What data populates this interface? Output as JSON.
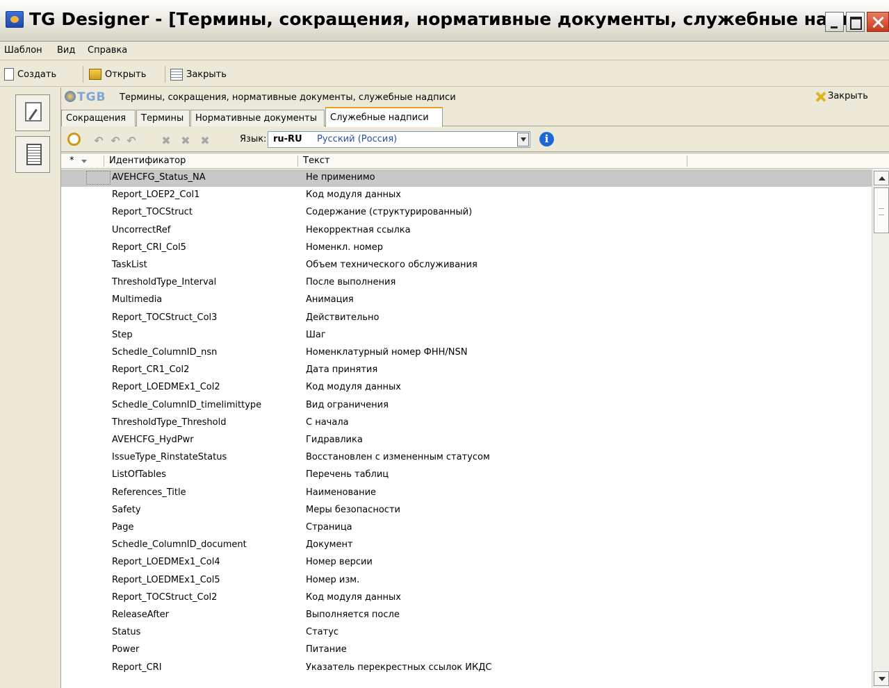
{
  "window": {
    "title": "TG Designer - [Термины, сокращения, нормативные документы, служебные надписи]"
  },
  "menu": [
    "Шаблон",
    "Вид",
    "Справка"
  ],
  "toolbar": {
    "create": "Создать",
    "open": "Открыть",
    "close": "Закрыть"
  },
  "doc": {
    "logo": "TGB",
    "title": "Термины, сокращения, нормативные документы, служебные надписи",
    "close": "Закрыть"
  },
  "tabs": [
    "Сокращения",
    "Термины",
    "Нормативные документы",
    "Служебные надписи"
  ],
  "active_tab": "Служебные надписи",
  "language": {
    "label": "Язык:",
    "code": "ru-RU",
    "name": "Русский (Россия)"
  },
  "grid": {
    "star": "*",
    "columns": [
      "Идентификатор",
      "Текст"
    ],
    "rows": [
      {
        "id": "AVEHCFG_Status_NA",
        "text": "Не применимо"
      },
      {
        "id": "Report_LOEP2_Col1",
        "text": "Код модуля данных"
      },
      {
        "id": "Report_TOCStruct",
        "text": "Содержание (структурированный)"
      },
      {
        "id": "UncorrectRef",
        "text": "Некорректная ссылка"
      },
      {
        "id": "Report_CRI_Col5",
        "text": "Номенкл. номер"
      },
      {
        "id": "TaskList",
        "text": "Объем технического обслуживания"
      },
      {
        "id": "ThresholdType_Interval",
        "text": "После выполнения"
      },
      {
        "id": "Multimedia",
        "text": "Анимация"
      },
      {
        "id": "Report_TOCStruct_Col3",
        "text": "Действительно"
      },
      {
        "id": "Step",
        "text": "Шаг"
      },
      {
        "id": "Schedle_ColumnID_nsn",
        "text": "Номенклатурный номер ФНН/NSN"
      },
      {
        "id": "Report_CR1_Col2",
        "text": "Дата принятия"
      },
      {
        "id": "Report_LOEDMEx1_Col2",
        "text": "Код модуля данных"
      },
      {
        "id": "Schedle_ColumnID_timelimittype",
        "text": "Вид ограничения"
      },
      {
        "id": "ThresholdType_Threshold",
        "text": "С начала"
      },
      {
        "id": "AVEHCFG_HydPwr",
        "text": "Гидравлика"
      },
      {
        "id": "IssueType_RinstateStatus",
        "text": "Восстановлен с измененным статусом"
      },
      {
        "id": "ListOfTables",
        "text": "Перечень таблиц"
      },
      {
        "id": "References_Title",
        "text": "Наименование"
      },
      {
        "id": "Safety",
        "text": "Меры безопасности"
      },
      {
        "id": "Page",
        "text": "Страница"
      },
      {
        "id": "Schedle_ColumnID_document",
        "text": "Документ"
      },
      {
        "id": "Report_LOEDMEx1_Col4",
        "text": "Номер версии"
      },
      {
        "id": "Report_LOEDMEx1_Col5",
        "text": "Номер изм."
      },
      {
        "id": "Report_TOCStruct_Col2",
        "text": "Код модуля данных"
      },
      {
        "id": "ReleaseAfter",
        "text": "Выполняется после"
      },
      {
        "id": "Status",
        "text": "Статус"
      },
      {
        "id": "Power",
        "text": "Питание"
      },
      {
        "id": "Report_CRI",
        "text": "Указатель перекрестных ссылок ИКДС"
      }
    ]
  }
}
